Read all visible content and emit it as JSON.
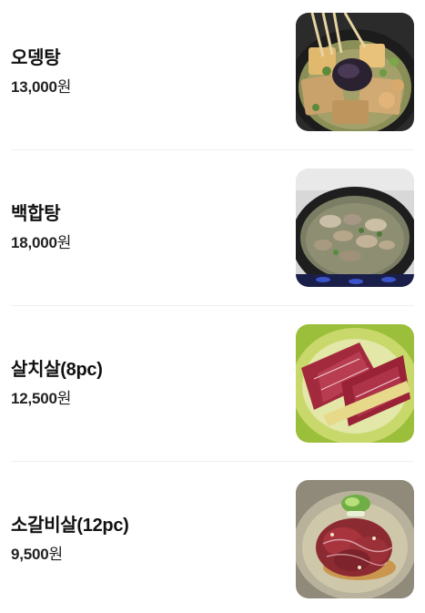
{
  "menu": {
    "items": [
      {
        "name": "오뎅탕",
        "price_number": "13,000",
        "price_unit": "원",
        "image_icon": "fishcake-soup-photo"
      },
      {
        "name": "백합탕",
        "price_number": "18,000",
        "price_unit": "원",
        "image_icon": "clam-soup-photo"
      },
      {
        "name": "살치살(8pc)",
        "price_number": "12,500",
        "price_unit": "원",
        "image_icon": "chuck-flap-beef-photo"
      },
      {
        "name": "소갈비살(12pc)",
        "price_number": "9,500",
        "price_unit": "원",
        "image_icon": "beef-rib-finger-photo"
      }
    ]
  },
  "colors": {
    "background": "#ffffff",
    "divider": "#efefef",
    "text": "#111111"
  }
}
